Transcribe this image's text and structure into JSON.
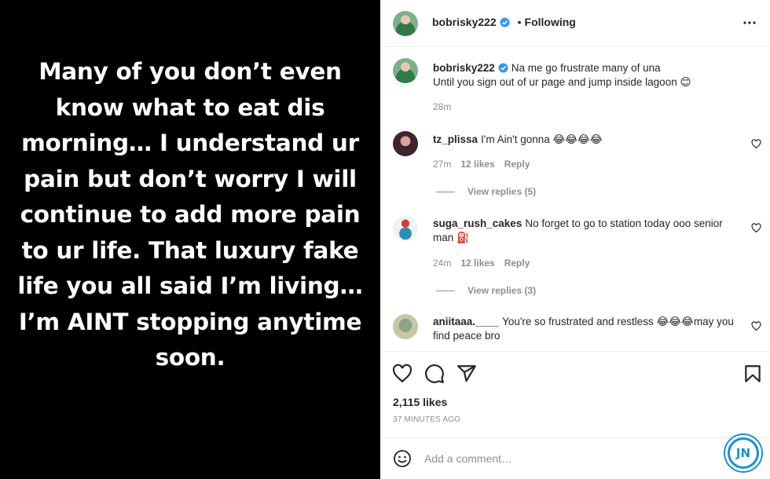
{
  "story": {
    "text": "Many of you don’t even know what to eat dis morning… I understand ur pain but don’t worry I will continue to add more pain to ur life. That luxury fake life you all said I’m living… I’m AINT stopping anytime soon."
  },
  "header": {
    "username": "bobrisky222",
    "separator": "•",
    "follow_status": "Following",
    "more_icon": "more-horizontal-icon"
  },
  "caption": {
    "username": "bobrisky222",
    "line1": "Na me go frustrate many of una",
    "line2": "Until you sign out of ur page and jump inside lagoon 😊",
    "time": "28m"
  },
  "comments": [
    {
      "username": "tz_plissa",
      "text": "I'm Ain't gonna 😂😂😂😂",
      "time": "27m",
      "likes": "12 likes",
      "reply_label": "Reply",
      "view_replies": "View replies (5)"
    },
    {
      "username": "suga_rush_cakes",
      "text": "No forget to go to station today ooo senior man ⛽",
      "time": "24m",
      "likes": "12 likes",
      "reply_label": "Reply",
      "view_replies": "View replies (3)"
    },
    {
      "username": "aniitaaa.____",
      "text": "You're so frustrated and restless 😂😂😂may you find peace bro"
    }
  ],
  "actions": {
    "like_icon": "heart-icon",
    "comment_icon": "comment-icon",
    "share_icon": "share-icon",
    "save_icon": "bookmark-icon",
    "likes_count": "2,115 likes",
    "timestamp": "37 MINUTES AGO"
  },
  "add_comment": {
    "placeholder": "Add a comment…",
    "emoji_icon": "smiley-icon"
  },
  "watermark": {
    "text": "JN"
  },
  "colors": {
    "text": "#262626",
    "secondary": "#8e8e8e",
    "verified": "#3897f0",
    "media_bg": "#000000"
  }
}
